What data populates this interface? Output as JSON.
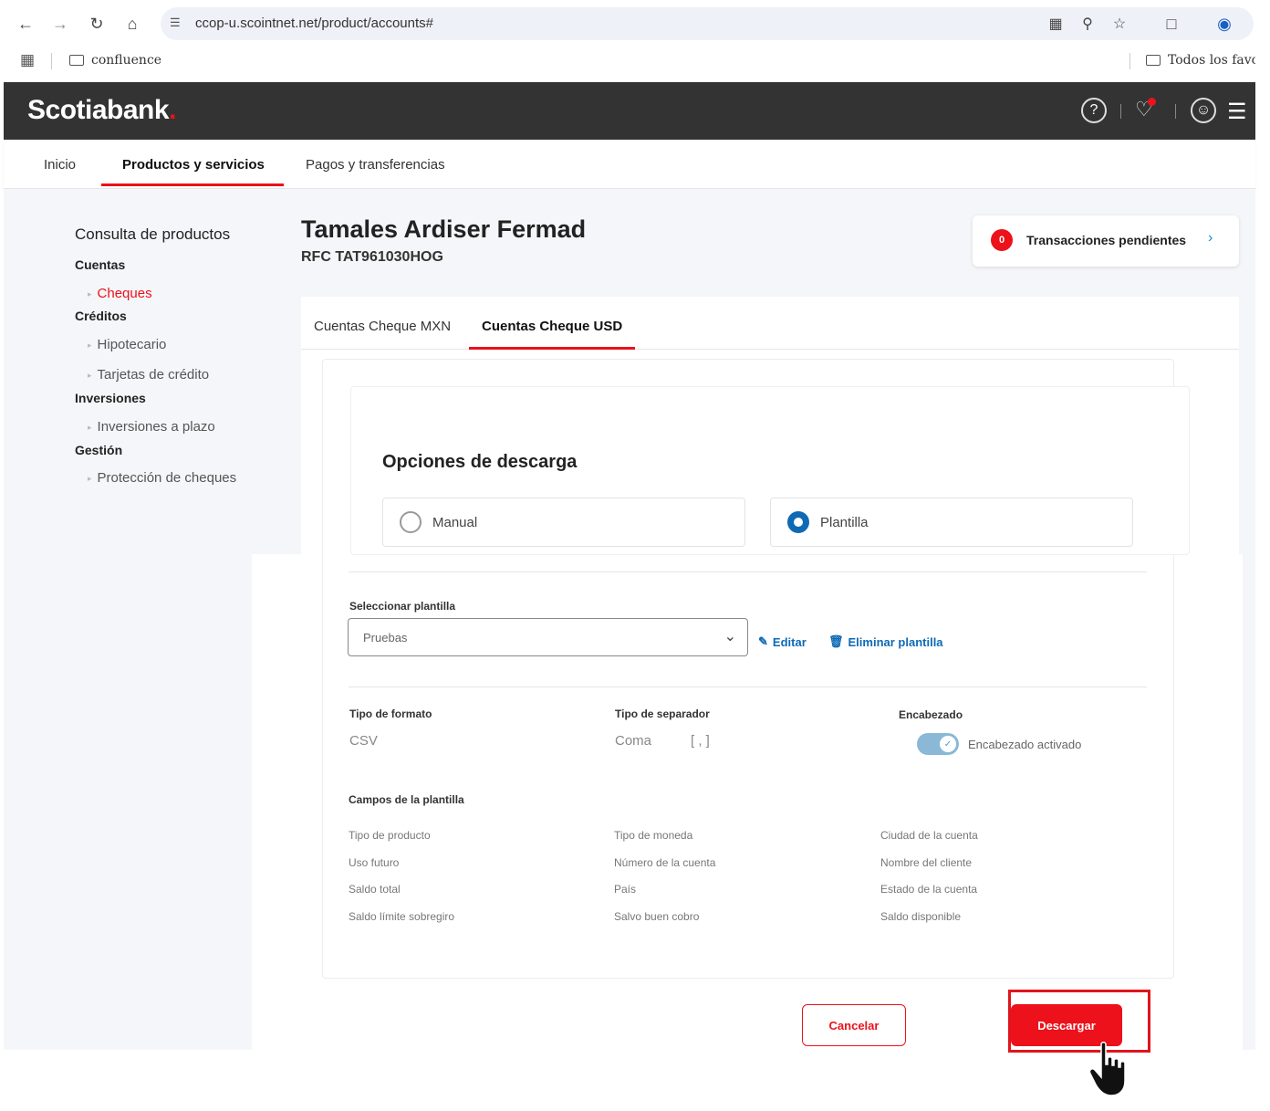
{
  "browser": {
    "url": "ccop-u.scointnet.net/product/accounts#",
    "bookmark": "confluence",
    "all_bookmarks": "Todos los favoritos"
  },
  "header": {
    "logo": "Scotiabank",
    "logo_dot": "."
  },
  "main_nav": {
    "items": [
      "Inicio",
      "Productos y servicios",
      "Pagos y transferencias"
    ]
  },
  "sidebar": {
    "title": "Consulta de productos",
    "groups": [
      {
        "label": "Cuentas",
        "items": [
          "Cheques"
        ]
      },
      {
        "label": "Créditos",
        "items": [
          "Hipotecario",
          "Tarjetas de crédito"
        ]
      },
      {
        "label": "Inversiones",
        "items": [
          "Inversiones a plazo"
        ]
      },
      {
        "label": "Gestión",
        "items": [
          "Protección de cheques"
        ]
      }
    ]
  },
  "customer": {
    "name": "Tamales Ardiser Fermad",
    "rfc": "RFC TAT961030HOG"
  },
  "pending": {
    "count": "0",
    "label": "Transacciones pendientes"
  },
  "tabs": [
    "Cuentas Cheque MXN",
    "Cuentas Cheque USD"
  ],
  "download": {
    "title": "Opciones de descarga",
    "options": [
      "Manual",
      "Plantilla"
    ],
    "selected_option": "Plantilla",
    "template_label": "Seleccionar plantilla",
    "template_value": "Pruebas",
    "edit_label": "Editar",
    "delete_label": "Eliminar plantilla",
    "format_label": "Tipo de formato",
    "format_value": "CSV",
    "separator_label": "Tipo de separador",
    "separator_value": "Coma",
    "separator_symbol": "[ , ]",
    "header_label": "Encabezado",
    "header_toggle_on": true,
    "header_toggle_text": "Encabezado activado",
    "fields_label": "Campos de la plantilla",
    "fields": [
      "Tipo de producto",
      "Tipo de moneda",
      "Ciudad de la cuenta",
      "Uso futuro",
      "Número de la cuenta",
      "Nombre del cliente",
      "Saldo total",
      "País",
      "Estado de la cuenta",
      "Saldo límite sobregiro",
      "Salvo buen cobro",
      "Saldo disponible"
    ]
  },
  "actions": {
    "cancel": "Cancelar",
    "download": "Descargar"
  },
  "colors": {
    "brand_red": "#ec111a",
    "header_dark": "#333333",
    "link_blue": "#0e6ab5"
  }
}
